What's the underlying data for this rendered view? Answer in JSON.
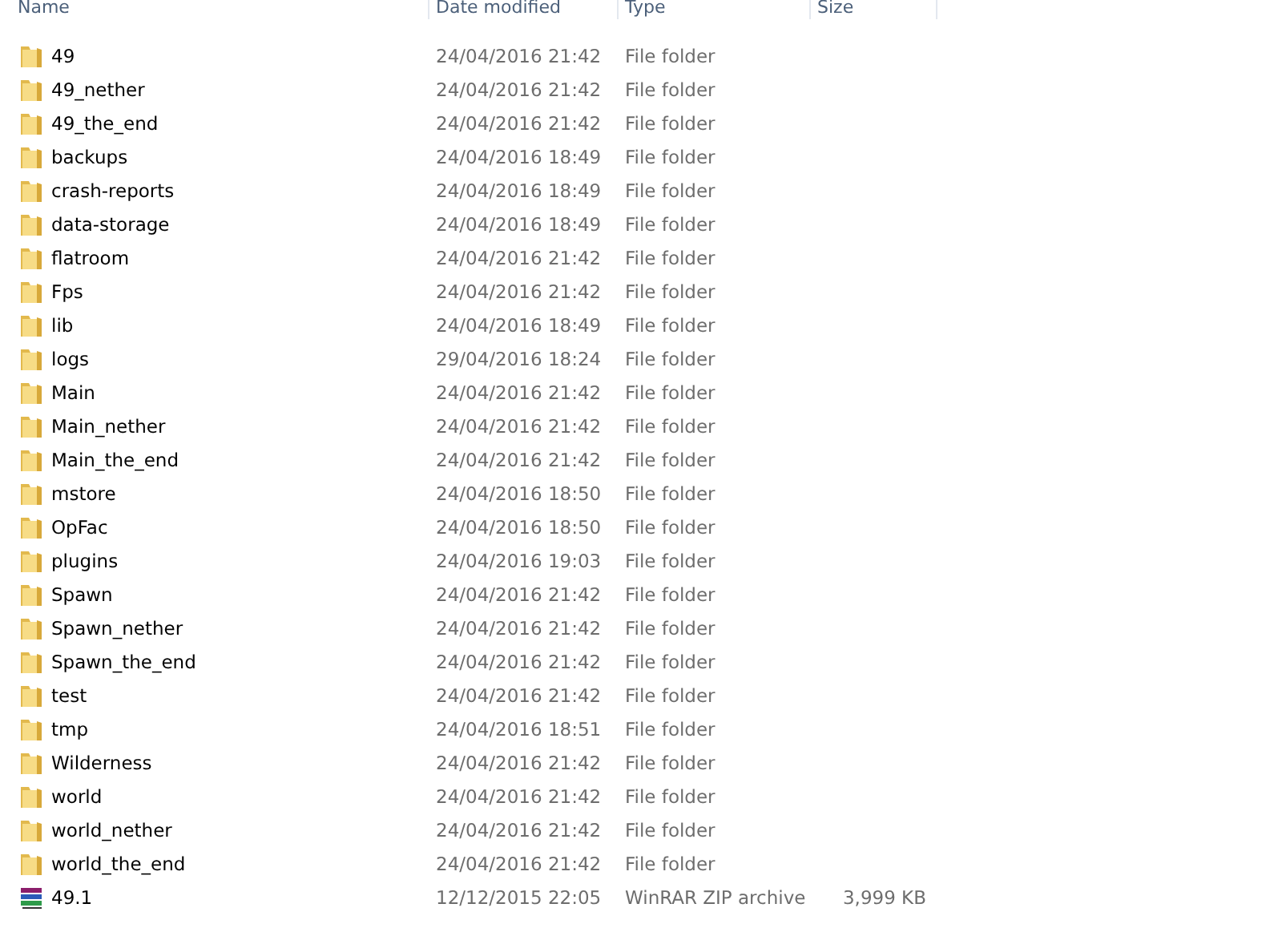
{
  "columns": [
    "Name",
    "Date modified",
    "Type",
    "Size"
  ],
  "rows": [
    {
      "kind": "folder",
      "name": "49",
      "date": "24/04/2016 21:42",
      "type": "File folder"
    },
    {
      "kind": "folder",
      "name": "49_nether",
      "date": "24/04/2016 21:42",
      "type": "File folder"
    },
    {
      "kind": "folder",
      "name": "49_the_end",
      "date": "24/04/2016 21:42",
      "type": "File folder"
    },
    {
      "kind": "folder",
      "name": "backups",
      "date": "24/04/2016 18:49",
      "type": "File folder"
    },
    {
      "kind": "folder",
      "name": "crash-reports",
      "date": "24/04/2016 18:49",
      "type": "File folder"
    },
    {
      "kind": "folder",
      "name": "data-storage",
      "date": "24/04/2016 18:49",
      "type": "File folder"
    },
    {
      "kind": "folder",
      "name": "flatroom",
      "date": "24/04/2016 21:42",
      "type": "File folder"
    },
    {
      "kind": "folder",
      "name": "Fps",
      "date": "24/04/2016 21:42",
      "type": "File folder"
    },
    {
      "kind": "folder",
      "name": "lib",
      "date": "24/04/2016 18:49",
      "type": "File folder"
    },
    {
      "kind": "folder",
      "name": "logs",
      "date": "29/04/2016 18:24",
      "type": "File folder"
    },
    {
      "kind": "folder",
      "name": "Main",
      "date": "24/04/2016 21:42",
      "type": "File folder"
    },
    {
      "kind": "folder",
      "name": "Main_nether",
      "date": "24/04/2016 21:42",
      "type": "File folder"
    },
    {
      "kind": "folder",
      "name": "Main_the_end",
      "date": "24/04/2016 21:42",
      "type": "File folder"
    },
    {
      "kind": "folder",
      "name": "mstore",
      "date": "24/04/2016 18:50",
      "type": "File folder"
    },
    {
      "kind": "folder",
      "name": "OpFac",
      "date": "24/04/2016 18:50",
      "type": "File folder"
    },
    {
      "kind": "folder",
      "name": "plugins",
      "date": "24/04/2016 19:03",
      "type": "File folder"
    },
    {
      "kind": "folder",
      "name": "Spawn",
      "date": "24/04/2016 21:42",
      "type": "File folder"
    },
    {
      "kind": "folder",
      "name": "Spawn_nether",
      "date": "24/04/2016 21:42",
      "type": "File folder"
    },
    {
      "kind": "folder",
      "name": "Spawn_the_end",
      "date": "24/04/2016 21:42",
      "type": "File folder"
    },
    {
      "kind": "folder",
      "name": "test",
      "date": "24/04/2016 21:42",
      "type": "File folder"
    },
    {
      "kind": "folder",
      "name": "tmp",
      "date": "24/04/2016 18:51",
      "type": "File folder"
    },
    {
      "kind": "folder",
      "name": "Wilderness",
      "date": "24/04/2016 21:42",
      "type": "File folder"
    },
    {
      "kind": "folder",
      "name": "world",
      "date": "24/04/2016 21:42",
      "type": "File folder"
    },
    {
      "kind": "folder",
      "name": "world_nether",
      "date": "24/04/2016 21:42",
      "type": "File folder"
    },
    {
      "kind": "folder",
      "name": "world_the_end",
      "date": "24/04/2016 21:42",
      "type": "File folder"
    },
    {
      "kind": "archive",
      "name": "49.1",
      "date": "12/12/2015 22:05",
      "type": "WinRAR ZIP archive",
      "size": "3,999 KB"
    }
  ]
}
